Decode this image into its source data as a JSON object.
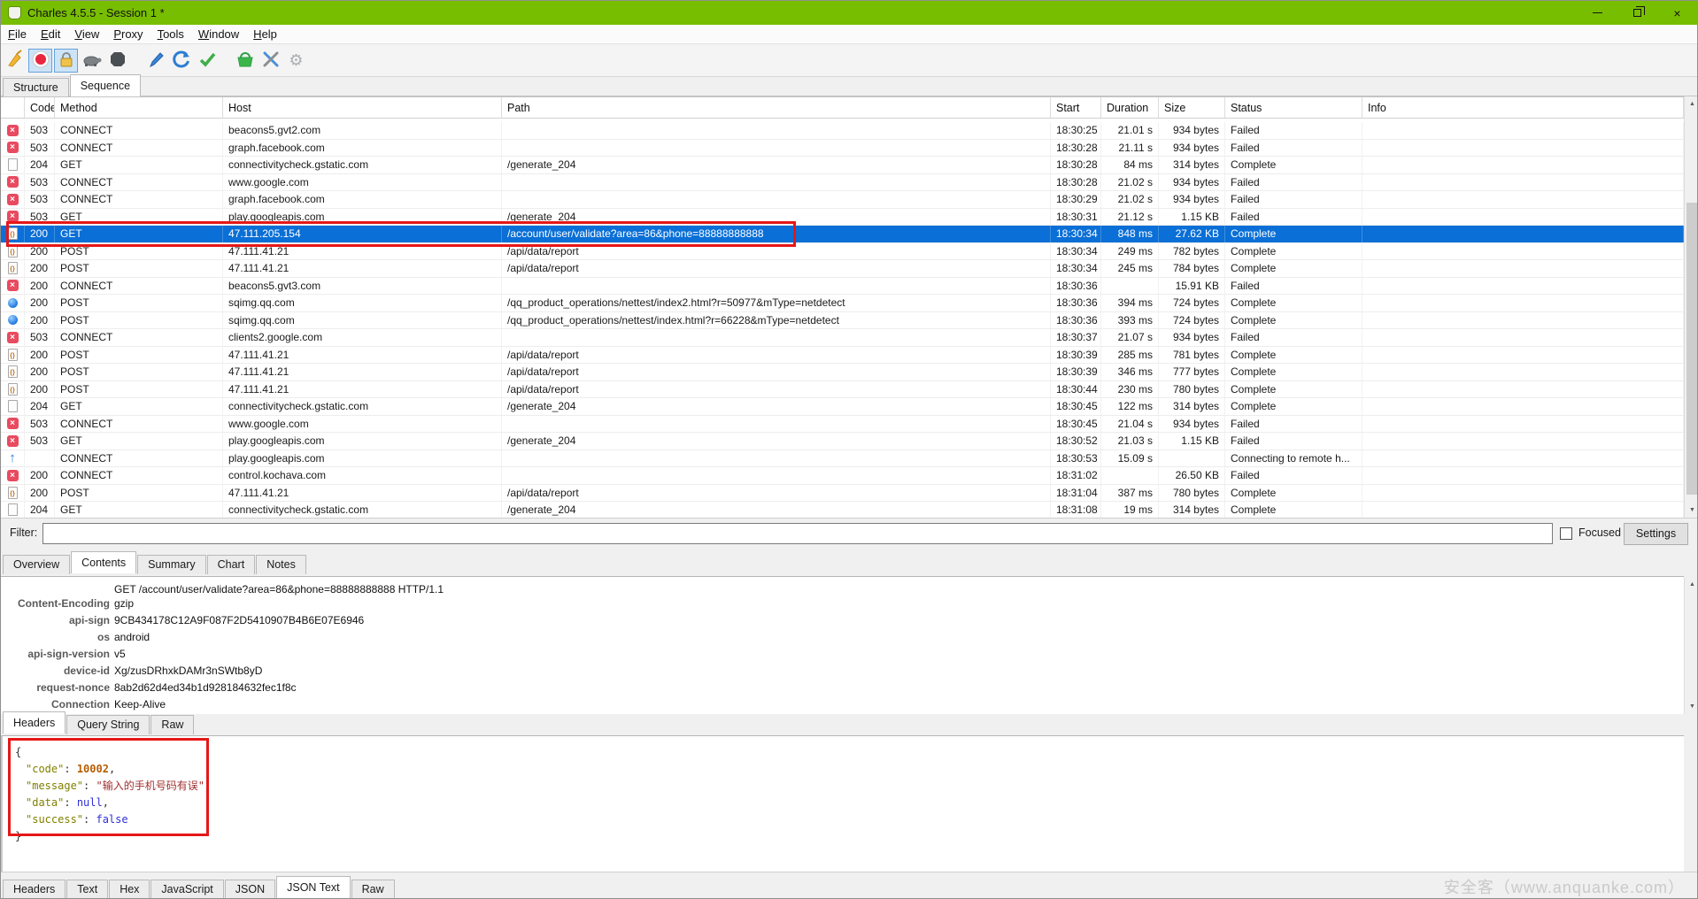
{
  "window": {
    "title": "Charles 4.5.5 - Session 1 *",
    "controls": [
      "minimize",
      "restore",
      "close"
    ]
  },
  "menu": {
    "items": [
      "File",
      "Edit",
      "View",
      "Proxy",
      "Tools",
      "Window",
      "Help"
    ]
  },
  "toolbar": {
    "icons": [
      {
        "name": "broom-icon",
        "pressed": false
      },
      {
        "name": "record-icon",
        "pressed": true
      },
      {
        "name": "lock-icon",
        "pressed": true
      },
      {
        "name": "turtle-icon",
        "pressed": false
      },
      {
        "name": "stop-icon",
        "pressed": false
      },
      {
        "name": "gap"
      },
      {
        "name": "pen-icon",
        "pressed": false
      },
      {
        "name": "refresh-icon",
        "pressed": false
      },
      {
        "name": "check-icon",
        "pressed": false
      },
      {
        "name": "gap"
      },
      {
        "name": "basket-icon",
        "pressed": false
      },
      {
        "name": "tools-icon",
        "pressed": false
      },
      {
        "name": "gear-icon",
        "pressed": false
      }
    ]
  },
  "main_tabs": {
    "items": [
      "Structure",
      "Sequence"
    ],
    "active": "Sequence"
  },
  "table": {
    "columns": [
      "Code",
      "Method",
      "Host",
      "Path",
      "Start",
      "Duration",
      "Size",
      "Status",
      "Info"
    ],
    "rows": [
      {
        "icon": "fail",
        "code": "503",
        "method": "CONNECT",
        "host": "beacons5.gvt2.com",
        "path": "",
        "start": "18:30:25",
        "duration": "21.01 s",
        "size": "934 bytes",
        "status": "Failed",
        "info": ""
      },
      {
        "icon": "fail",
        "code": "503",
        "method": "CONNECT",
        "host": "graph.facebook.com",
        "path": "",
        "start": "18:30:28",
        "duration": "21.11 s",
        "size": "934 bytes",
        "status": "Failed",
        "info": ""
      },
      {
        "icon": "doc",
        "code": "204",
        "method": "GET",
        "host": "connectivitycheck.gstatic.com",
        "path": "/generate_204",
        "start": "18:30:28",
        "duration": "84 ms",
        "size": "314 bytes",
        "status": "Complete",
        "info": ""
      },
      {
        "icon": "fail",
        "code": "503",
        "method": "CONNECT",
        "host": "www.google.com",
        "path": "",
        "start": "18:30:28",
        "duration": "21.02 s",
        "size": "934 bytes",
        "status": "Failed",
        "info": ""
      },
      {
        "icon": "fail",
        "code": "503",
        "method": "CONNECT",
        "host": "graph.facebook.com",
        "path": "",
        "start": "18:30:29",
        "duration": "21.02 s",
        "size": "934 bytes",
        "status": "Failed",
        "info": ""
      },
      {
        "icon": "fail",
        "code": "503",
        "method": "GET",
        "host": "play.googleapis.com",
        "path": "/generate_204",
        "start": "18:30:31",
        "duration": "21.12 s",
        "size": "1.15 KB",
        "status": "Failed",
        "info": ""
      },
      {
        "icon": "json",
        "code": "200",
        "method": "GET",
        "host": "47.111.205.154",
        "path": "/account/user/validate?area=86&phone=88888888888",
        "start": "18:30:34",
        "duration": "848 ms",
        "size": "27.62 KB",
        "status": "Complete",
        "info": "",
        "selected": true
      },
      {
        "icon": "json",
        "code": "200",
        "method": "POST",
        "host": "47.111.41.21",
        "path": "/api/data/report",
        "start": "18:30:34",
        "duration": "249 ms",
        "size": "782 bytes",
        "status": "Complete",
        "info": ""
      },
      {
        "icon": "json",
        "code": "200",
        "method": "POST",
        "host": "47.111.41.21",
        "path": "/api/data/report",
        "start": "18:30:34",
        "duration": "245 ms",
        "size": "784 bytes",
        "status": "Complete",
        "info": ""
      },
      {
        "icon": "fail",
        "code": "200",
        "method": "CONNECT",
        "host": "beacons5.gvt3.com",
        "path": "",
        "start": "18:30:36",
        "duration": "",
        "size": "15.91 KB",
        "status": "Failed",
        "info": ""
      },
      {
        "icon": "dot",
        "code": "200",
        "method": "POST",
        "host": "sqimg.qq.com",
        "path": "/qq_product_operations/nettest/index2.html?r=50977&mType=netdetect",
        "start": "18:30:36",
        "duration": "394 ms",
        "size": "724 bytes",
        "status": "Complete",
        "info": ""
      },
      {
        "icon": "dot",
        "code": "200",
        "method": "POST",
        "host": "sqimg.qq.com",
        "path": "/qq_product_operations/nettest/index.html?r=66228&mType=netdetect",
        "start": "18:30:36",
        "duration": "393 ms",
        "size": "724 bytes",
        "status": "Complete",
        "info": ""
      },
      {
        "icon": "fail",
        "code": "503",
        "method": "CONNECT",
        "host": "clients2.google.com",
        "path": "",
        "start": "18:30:37",
        "duration": "21.07 s",
        "size": "934 bytes",
        "status": "Failed",
        "info": ""
      },
      {
        "icon": "json",
        "code": "200",
        "method": "POST",
        "host": "47.111.41.21",
        "path": "/api/data/report",
        "start": "18:30:39",
        "duration": "285 ms",
        "size": "781 bytes",
        "status": "Complete",
        "info": ""
      },
      {
        "icon": "json",
        "code": "200",
        "method": "POST",
        "host": "47.111.41.21",
        "path": "/api/data/report",
        "start": "18:30:39",
        "duration": "346 ms",
        "size": "777 bytes",
        "status": "Complete",
        "info": ""
      },
      {
        "icon": "json",
        "code": "200",
        "method": "POST",
        "host": "47.111.41.21",
        "path": "/api/data/report",
        "start": "18:30:44",
        "duration": "230 ms",
        "size": "780 bytes",
        "status": "Complete",
        "info": ""
      },
      {
        "icon": "doc",
        "code": "204",
        "method": "GET",
        "host": "connectivitycheck.gstatic.com",
        "path": "/generate_204",
        "start": "18:30:45",
        "duration": "122 ms",
        "size": "314 bytes",
        "status": "Complete",
        "info": ""
      },
      {
        "icon": "fail",
        "code": "503",
        "method": "CONNECT",
        "host": "www.google.com",
        "path": "",
        "start": "18:30:45",
        "duration": "21.04 s",
        "size": "934 bytes",
        "status": "Failed",
        "info": ""
      },
      {
        "icon": "fail",
        "code": "503",
        "method": "GET",
        "host": "play.googleapis.com",
        "path": "/generate_204",
        "start": "18:30:52",
        "duration": "21.03 s",
        "size": "1.15 KB",
        "status": "Failed",
        "info": ""
      },
      {
        "icon": "arrow",
        "code": "",
        "method": "CONNECT",
        "host": "play.googleapis.com",
        "path": "",
        "start": "18:30:53",
        "duration": "15.09 s",
        "size": "",
        "status": "Connecting to remote h...",
        "info": ""
      },
      {
        "icon": "fail",
        "code": "200",
        "method": "CONNECT",
        "host": "control.kochava.com",
        "path": "",
        "start": "18:31:02",
        "duration": "",
        "size": "26.50 KB",
        "status": "Failed",
        "info": ""
      },
      {
        "icon": "json",
        "code": "200",
        "method": "POST",
        "host": "47.111.41.21",
        "path": "/api/data/report",
        "start": "18:31:04",
        "duration": "387 ms",
        "size": "780 bytes",
        "status": "Complete",
        "info": ""
      },
      {
        "icon": "doc",
        "code": "204",
        "method": "GET",
        "host": "connectivitycheck.gstatic.com",
        "path": "/generate_204",
        "start": "18:31:08",
        "duration": "19 ms",
        "size": "314 bytes",
        "status": "Complete",
        "info": ""
      }
    ]
  },
  "filter": {
    "label": "Filter:",
    "value": "",
    "focused_label": "Focused",
    "focused_checked": false,
    "settings_label": "Settings"
  },
  "view_tabs": {
    "items": [
      "Overview",
      "Contents",
      "Summary",
      "Chart",
      "Notes"
    ],
    "active": "Contents"
  },
  "request": {
    "request_line": "GET /account/user/validate?area=86&phone=88888888888 HTTP/1.1",
    "headers": [
      {
        "key": "Content-Encoding",
        "value": "gzip"
      },
      {
        "key": "api-sign",
        "value": "9CB434178C12A9F087F2D5410907B4B6E07E6946"
      },
      {
        "key": "os",
        "value": "android"
      },
      {
        "key": "api-sign-version",
        "value": "v5"
      },
      {
        "key": "device-id",
        "value": "Xg/zusDRhxkDAMr3nSWtb8yD"
      },
      {
        "key": "request-nonce",
        "value": "8ab2d62d4ed34b1d928184632fec1f8c"
      },
      {
        "key": "Connection",
        "value": "Keep-Alive"
      }
    ],
    "tabs": {
      "items": [
        "Headers",
        "Query String",
        "Raw"
      ],
      "active": "Headers"
    }
  },
  "response": {
    "json_lines": [
      {
        "brace": "{"
      },
      {
        "key": "code",
        "value": "10002",
        "type": "number",
        "comma": true
      },
      {
        "key": "message",
        "value": "输入的手机号码有误",
        "type": "string",
        "comma": true
      },
      {
        "key": "data",
        "value": "null",
        "type": "keyword",
        "comma": true
      },
      {
        "key": "success",
        "value": "false",
        "type": "keyword",
        "comma": false
      },
      {
        "brace": "}"
      }
    ],
    "tabs": {
      "items": [
        "Headers",
        "Text",
        "Hex",
        "JavaScript",
        "JSON",
        "JSON Text",
        "Raw"
      ],
      "active": "JSON Text"
    }
  },
  "watermark": "安全客（www.anquanke.com）",
  "colors": {
    "titlebar_green": "#78be00",
    "selection_blue": "#0a6fd6",
    "annotation_red": "#e51717",
    "fail_icon_red": "#e84a5f",
    "json_key": "#808000",
    "json_number": "#b85c00",
    "json_string": "#a03030",
    "json_keyword": "#2f2fd4"
  }
}
